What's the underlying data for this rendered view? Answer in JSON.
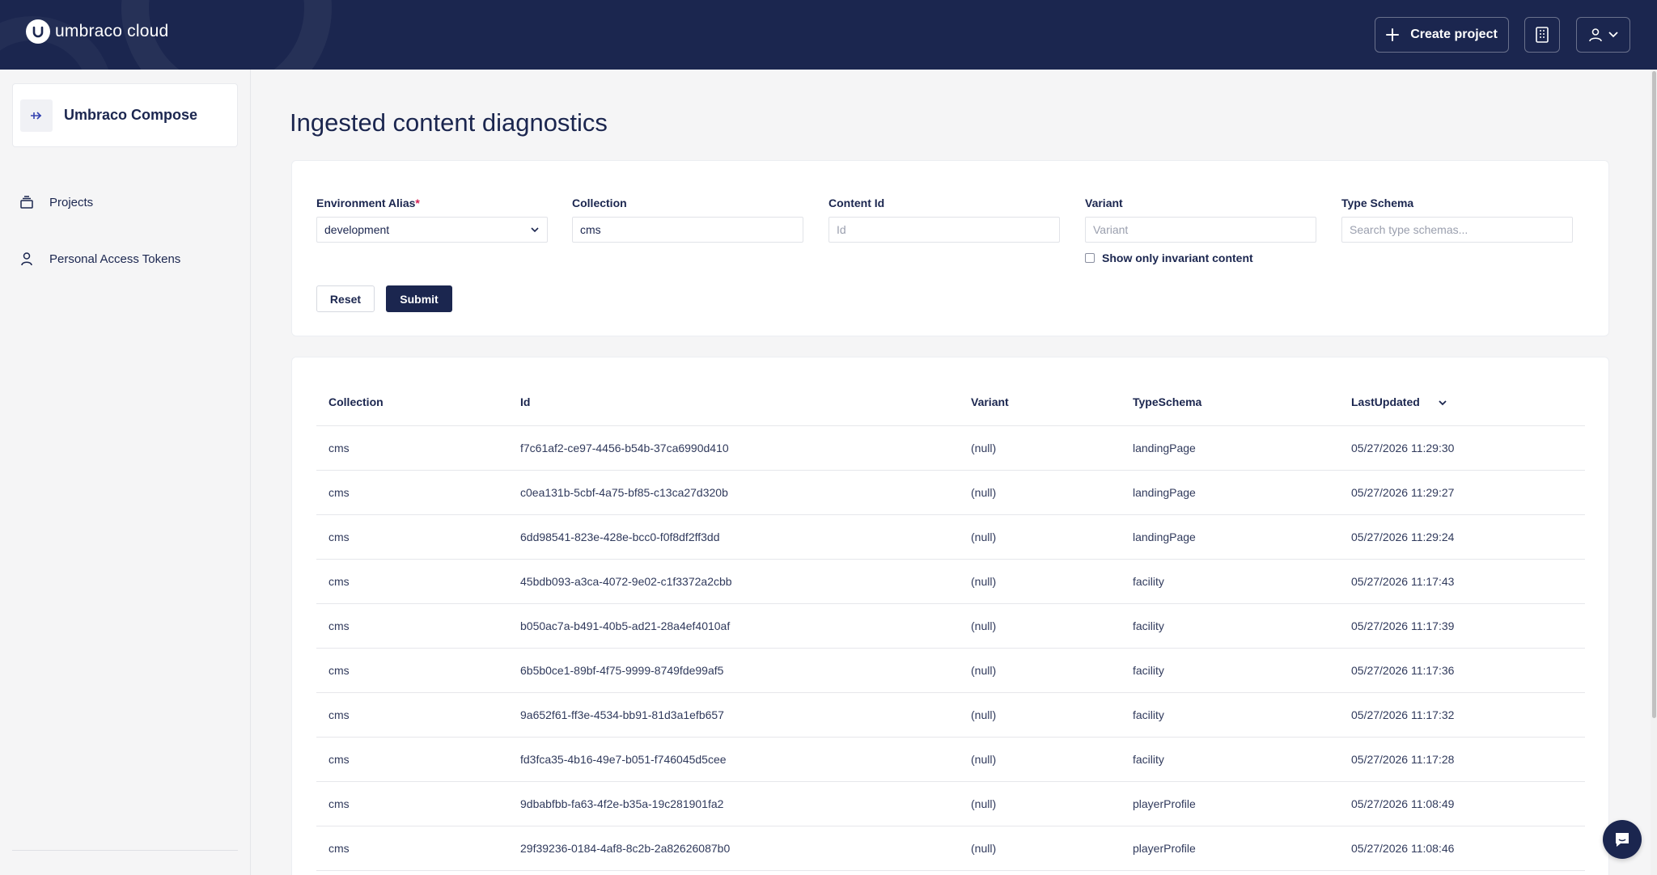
{
  "brand": {
    "logo_text": "umbraco cloud",
    "color": "#1b264f"
  },
  "header": {
    "create_project_label": "Create project"
  },
  "sidebar": {
    "project_name": "Umbraco Compose",
    "items": [
      {
        "label": "Projects",
        "icon": "stack-icon"
      },
      {
        "label": "Personal Access Tokens",
        "icon": "user-icon"
      }
    ]
  },
  "page": {
    "title": "Ingested content diagnostics"
  },
  "filters": {
    "environment_alias": {
      "label": "Environment Alias",
      "required_mark": "*",
      "value": "development"
    },
    "collection": {
      "label": "Collection",
      "value": "cms"
    },
    "content_id": {
      "label": "Content Id",
      "placeholder": "Id"
    },
    "variant": {
      "label": "Variant",
      "placeholder": "Variant"
    },
    "invariant_checkbox": {
      "label": "Show only invariant content",
      "checked": false
    },
    "type_schema": {
      "label": "Type Schema",
      "placeholder": "Search type schemas..."
    },
    "reset_label": "Reset",
    "submit_label": "Submit"
  },
  "table": {
    "headers": [
      "Collection",
      "Id",
      "Variant",
      "TypeSchema",
      "LastUpdated"
    ],
    "rows": [
      [
        "cms",
        "f7c61af2-ce97-4456-b54b-37ca6990d410",
        "(null)",
        "landingPage",
        "05/27/2026 11:29:30"
      ],
      [
        "cms",
        "c0ea131b-5cbf-4a75-bf85-c13ca27d320b",
        "(null)",
        "landingPage",
        "05/27/2026 11:29:27"
      ],
      [
        "cms",
        "6dd98541-823e-428e-bcc0-f0f8df2ff3dd",
        "(null)",
        "landingPage",
        "05/27/2026 11:29:24"
      ],
      [
        "cms",
        "45bdb093-a3ca-4072-9e02-c1f3372a2cbb",
        "(null)",
        "facility",
        "05/27/2026 11:17:43"
      ],
      [
        "cms",
        "b050ac7a-b491-40b5-ad21-28a4ef4010af",
        "(null)",
        "facility",
        "05/27/2026 11:17:39"
      ],
      [
        "cms",
        "6b5b0ce1-89bf-4f75-9999-8749fde99af5",
        "(null)",
        "facility",
        "05/27/2026 11:17:36"
      ],
      [
        "cms",
        "9a652f61-ff3e-4534-bb91-81d3a1efb657",
        "(null)",
        "facility",
        "05/27/2026 11:17:32"
      ],
      [
        "cms",
        "fd3fca35-4b16-49e7-b051-f746045d5cee",
        "(null)",
        "facility",
        "05/27/2026 11:17:28"
      ],
      [
        "cms",
        "9dbabfbb-fa63-4f2e-b35a-19c281901fa2",
        "(null)",
        "playerProfile",
        "05/27/2026 11:08:49"
      ],
      [
        "cms",
        "29f39236-0184-4af8-8c2b-2a82626087b0",
        "(null)",
        "playerProfile",
        "05/27/2026 11:08:46"
      ]
    ]
  }
}
